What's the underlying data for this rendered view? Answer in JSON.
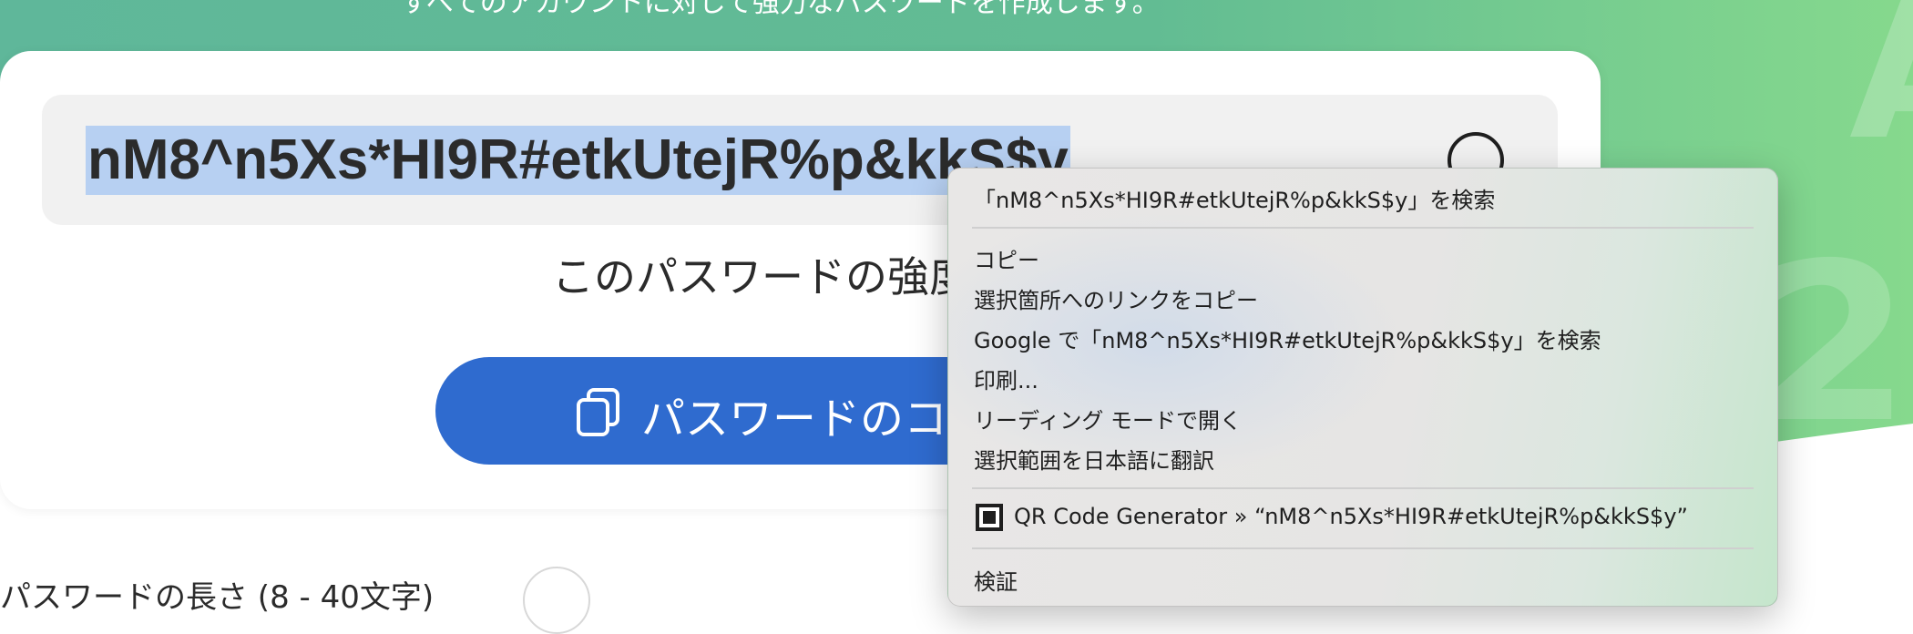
{
  "hero": {
    "subtitle": "すべてのアカウントに対して強力なパスワードを作成します。"
  },
  "generator": {
    "password": "nM8^n5Xs*HI9R#etkUtejR%p&kkS$y",
    "strength_label": "このパスワードの強度",
    "copy_button_label": "パスワードのコピー",
    "length_label": "パスワードの長さ (8 - 40文字)"
  },
  "context_menu": {
    "items": [
      {
        "label": "「nM8^n5Xs*HI9R#etkUtejR%p&kkS$y」を検索"
      },
      {
        "label": "コピー"
      },
      {
        "label": "選択箇所へのリンクをコピー"
      },
      {
        "label": "Google で「nM8^n5Xs*HI9R#etkUtejR%p&kkS$y」を検索"
      },
      {
        "label": "印刷..."
      },
      {
        "label": "リーディング モードで開く"
      },
      {
        "label": "選択範囲を日本語に翻訳"
      },
      {
        "label": "QR Code Generator » “nM8^n5Xs*HI9R#etkUtejR%p&kkS$y”",
        "icon": "qr-code-icon"
      },
      {
        "label": "検証"
      }
    ]
  },
  "colors": {
    "hero_green": "#5cb893",
    "accent_blue": "#2f6bcf",
    "selection": "#b7d0f2"
  }
}
